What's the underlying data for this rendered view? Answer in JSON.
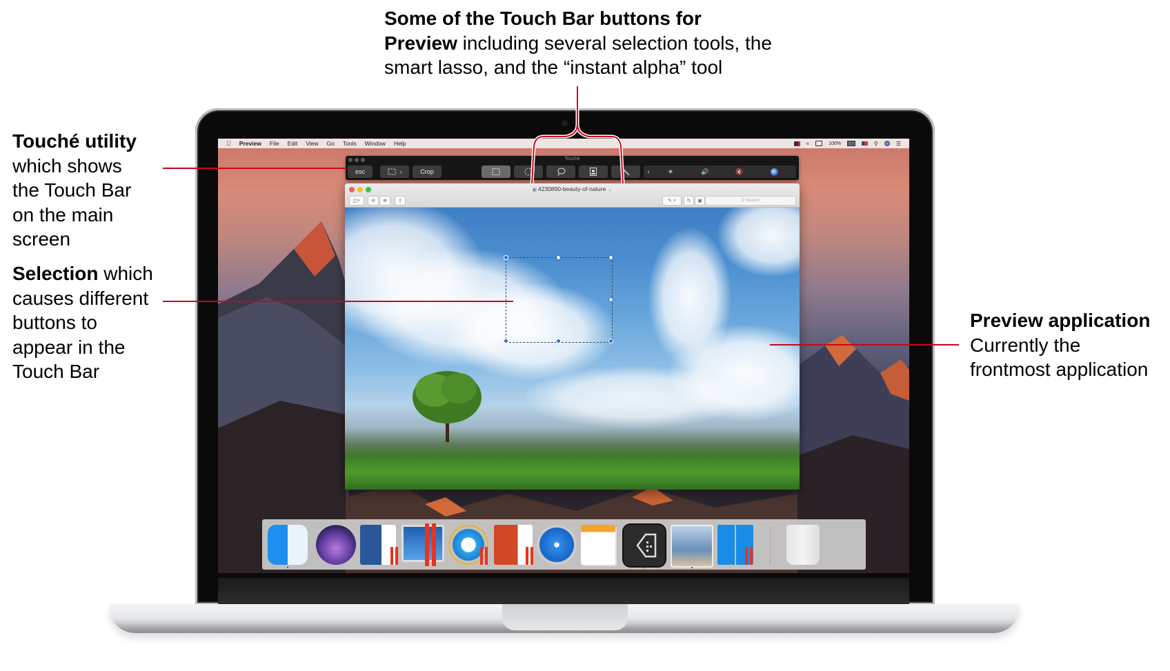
{
  "annotations": {
    "top": {
      "bold": "Some of the Touch Bar buttons for",
      "line2_bold": "Preview",
      "line2_rest": " including several selection tools, the",
      "line3": "smart lasso, and the “instant alpha” tool"
    },
    "touche": {
      "bold": "Touché utility",
      "lines": [
        "which shows",
        "the Touch Bar",
        "on the main",
        "screen"
      ]
    },
    "selection": {
      "bold": "Selection",
      "rest": " which",
      "lines": [
        "causes different",
        "buttons to",
        "appear in the",
        "Touch Bar"
      ]
    },
    "preview": {
      "bold": "Preview application",
      "lines": [
        "Currently the",
        "frontmost application"
      ]
    },
    "line_color": "#d0021b"
  },
  "menubar": {
    "apple_icon": "apple-logo-icon",
    "items": [
      "Preview",
      "File",
      "Edit",
      "View",
      "Go",
      "Tools",
      "Window",
      "Help"
    ],
    "status": {
      "battery_percent": "100%",
      "icons": [
        "app-status-icon",
        "wifi-icon",
        "airplay-icon",
        "battery-icon",
        "us-flag-input-icon",
        "spotlight-search-icon",
        "siri-icon",
        "notification-center-icon"
      ]
    }
  },
  "touche": {
    "title": "Touché",
    "esc_label": "esc",
    "crop_label": "Crop",
    "buttons": [
      {
        "name": "rectangular-selection",
        "selected": true
      },
      {
        "name": "elliptical-selection",
        "selected": false
      },
      {
        "name": "smart-lasso",
        "selected": false
      },
      {
        "name": "portrait-selection",
        "selected": false
      },
      {
        "name": "instant-alpha",
        "selected": false
      }
    ],
    "control_strip": [
      "collapse-chevron",
      "brightness",
      "volume",
      "mute",
      "siri"
    ]
  },
  "preview": {
    "title": "4230890-beauty-of-nature",
    "search_placeholder": "Search",
    "toolbar": [
      "sidebar",
      "zoom-out",
      "zoom-in",
      "share",
      "markup",
      "rotate",
      "toolbox"
    ]
  },
  "dock": {
    "apps": [
      {
        "name": "Finder",
        "running": true
      },
      {
        "name": "Siri",
        "running": false
      },
      {
        "name": "Microsoft Word (Parallels)",
        "running": false
      },
      {
        "name": "Windows 10 (Parallels)",
        "running": false
      },
      {
        "name": "Internet Explorer (Parallels)",
        "running": false
      },
      {
        "name": "Microsoft PowerPoint (Parallels)",
        "running": false
      },
      {
        "name": "Safari",
        "running": false
      },
      {
        "name": "Pages",
        "running": false
      },
      {
        "name": "Touché",
        "running": true
      },
      {
        "name": "Preview",
        "running": true
      },
      {
        "name": "Windows Start (Parallels)",
        "running": false
      },
      {
        "name": "Trash",
        "running": false
      }
    ]
  }
}
